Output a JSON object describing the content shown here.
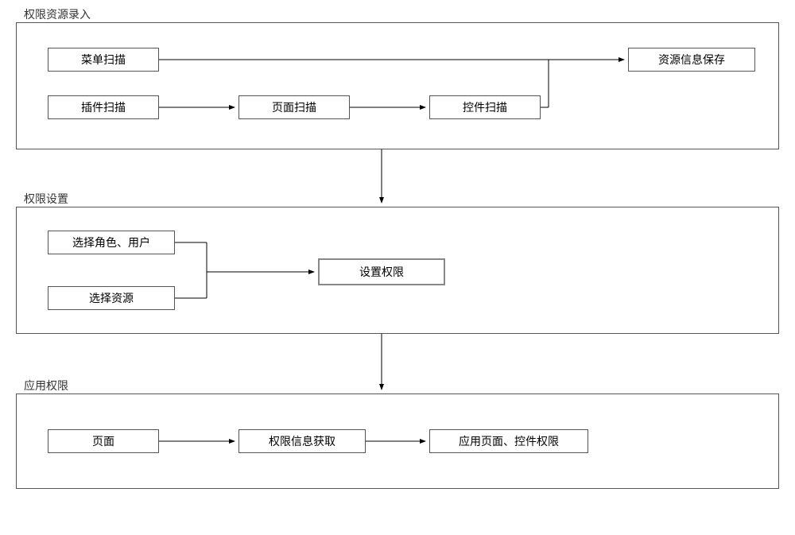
{
  "sections": {
    "s1": {
      "label": "权限资源录入"
    },
    "s2": {
      "label": "权限设置"
    },
    "s3": {
      "label": "应用权限"
    }
  },
  "nodes": {
    "menu_scan": "菜单扫描",
    "plugin_scan": "插件扫描",
    "page_scan": "页面扫描",
    "control_scan": "控件扫描",
    "save_res": "资源信息保存",
    "sel_role": "选择角色、用户",
    "sel_res": "选择资源",
    "set_perm": "设置权限",
    "page": "页面",
    "get_perm": "权限信息获取",
    "apply_perm": "应用页面、控件权限"
  }
}
